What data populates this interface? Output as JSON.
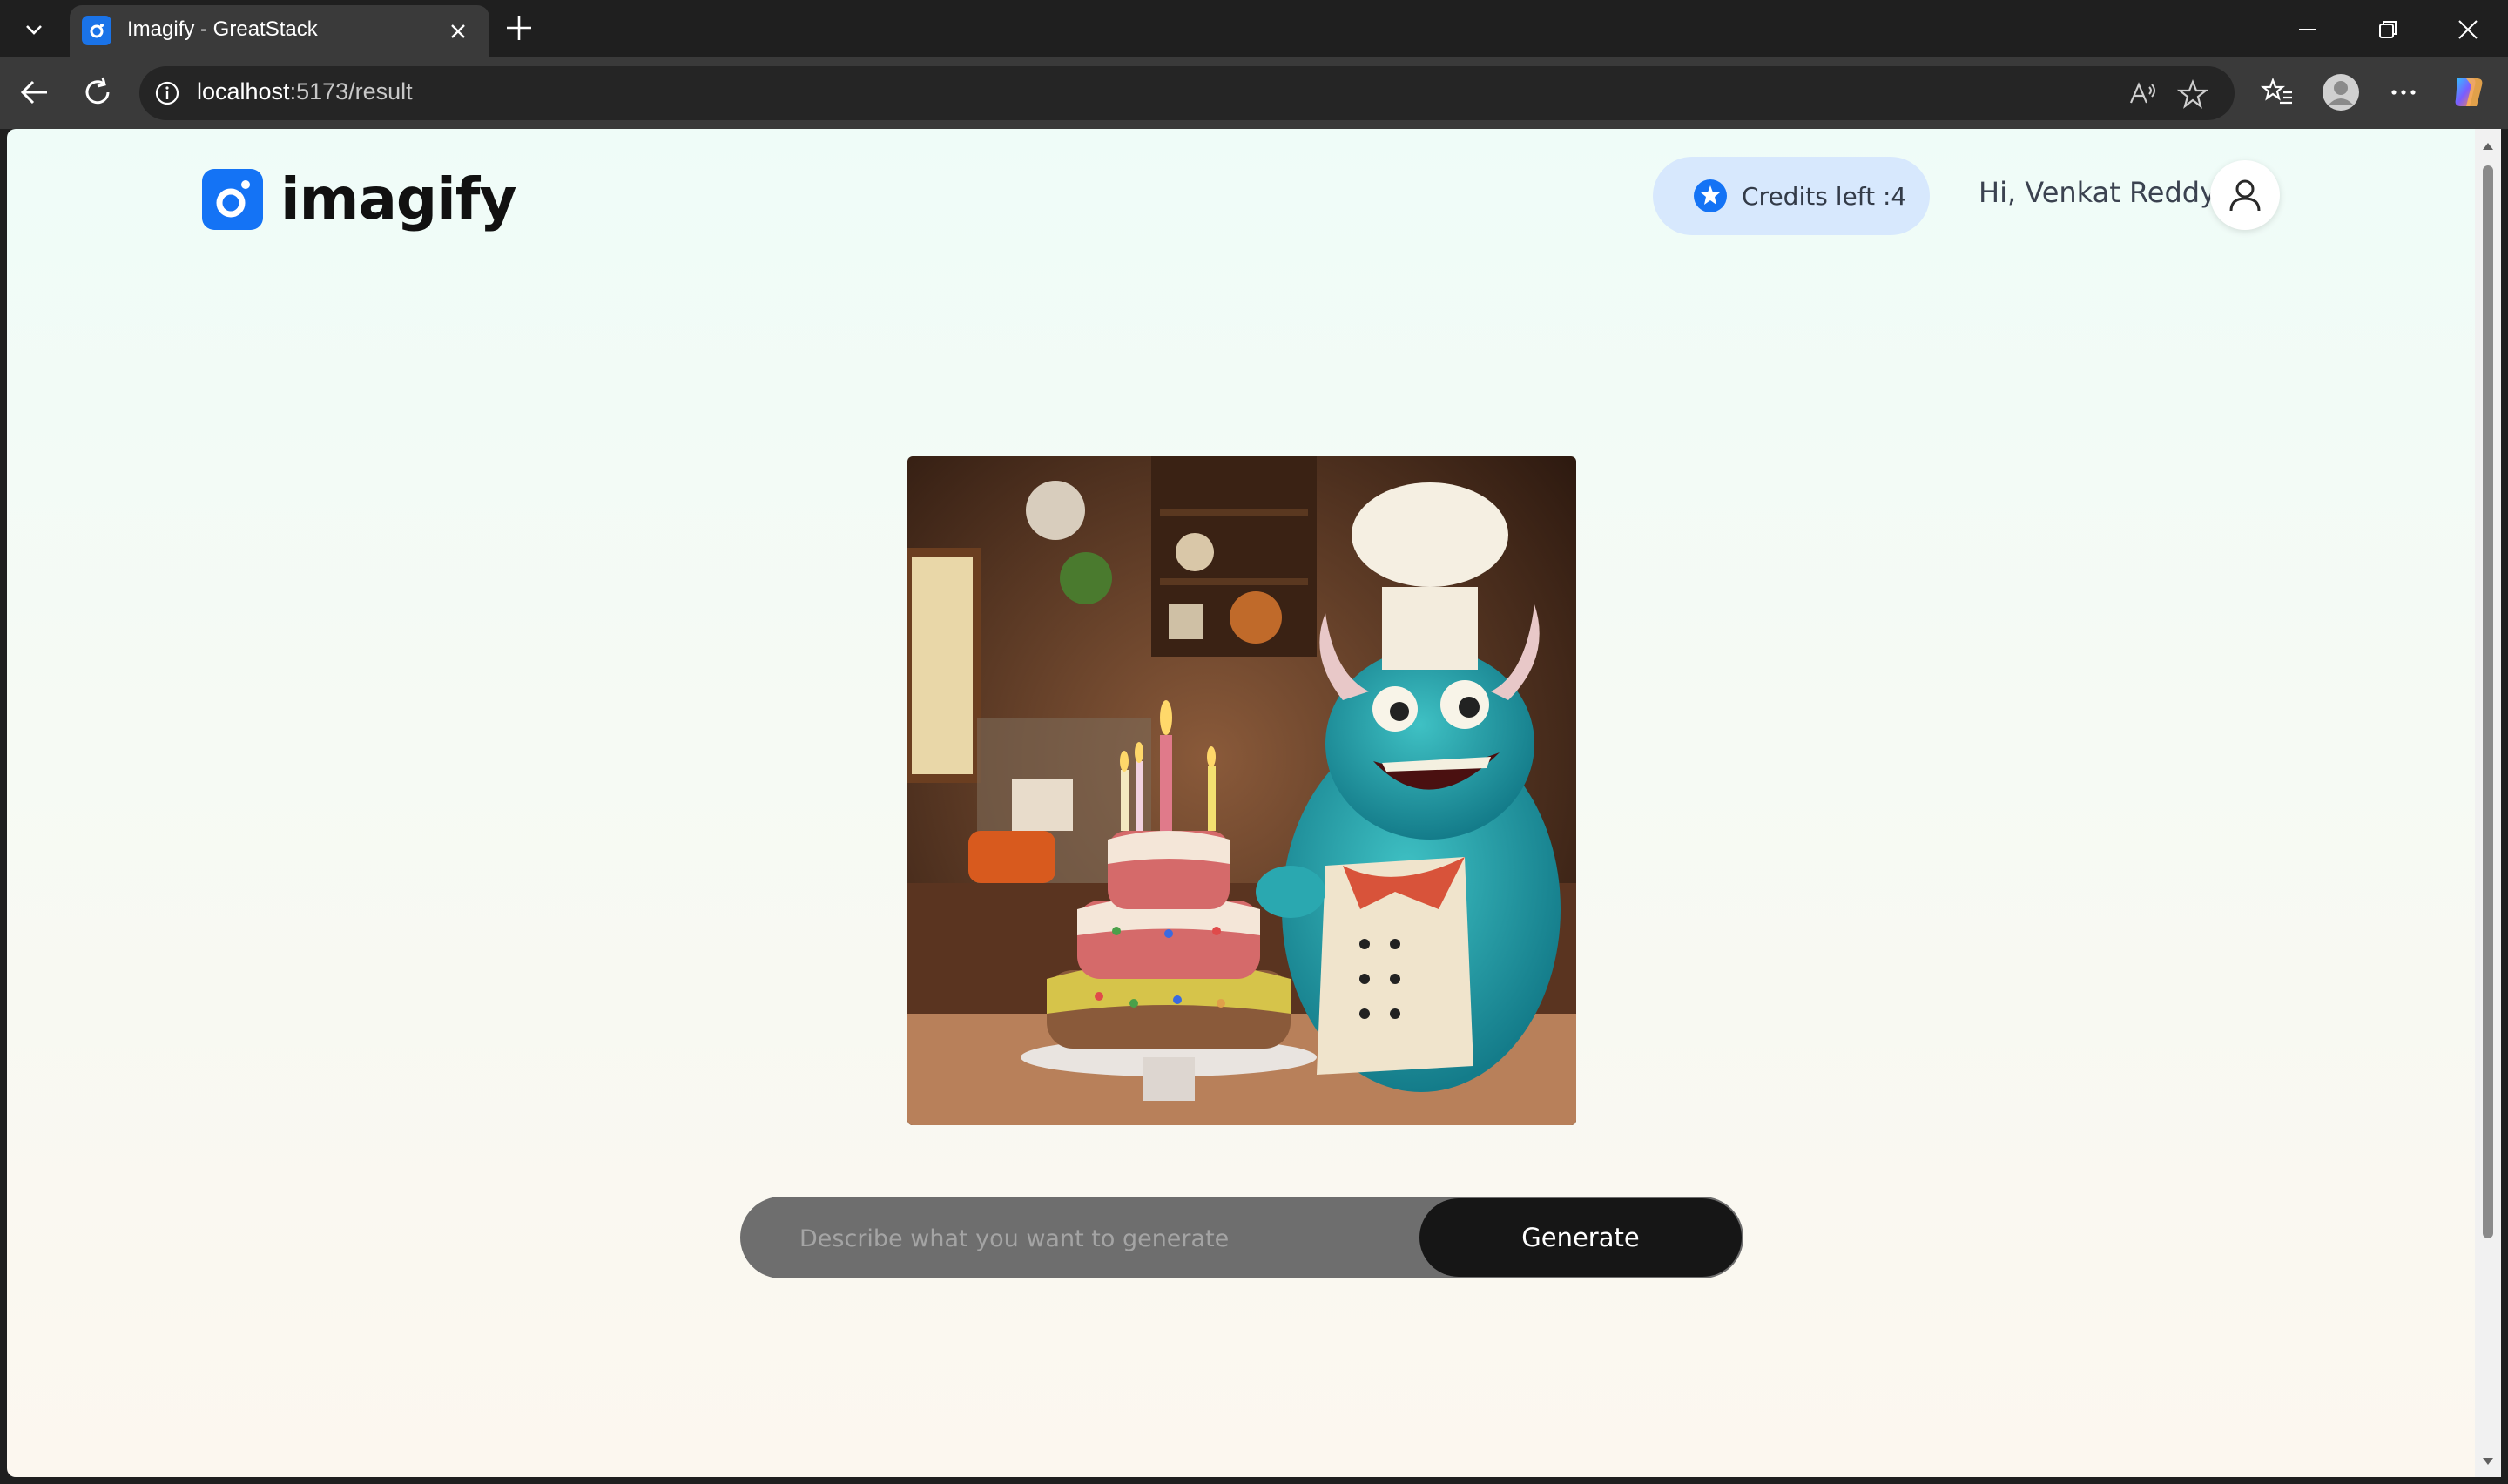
{
  "browser": {
    "tab_title": "Imagify - GreatStack",
    "url_host": "localhost",
    "url_path": ":5173/result"
  },
  "header": {
    "logo_text": "imagify",
    "credits_label": "Credits left :4",
    "greeting": "Hi, Venkat Reddy"
  },
  "prompt": {
    "placeholder": "Describe what you want to generate",
    "value": "",
    "button_label": "Generate"
  },
  "colors": {
    "brand_blue": "#1473f5",
    "credits_bg": "#d7e8fd",
    "button_dark": "#161616",
    "prompt_bg": "#6e6e6e"
  }
}
